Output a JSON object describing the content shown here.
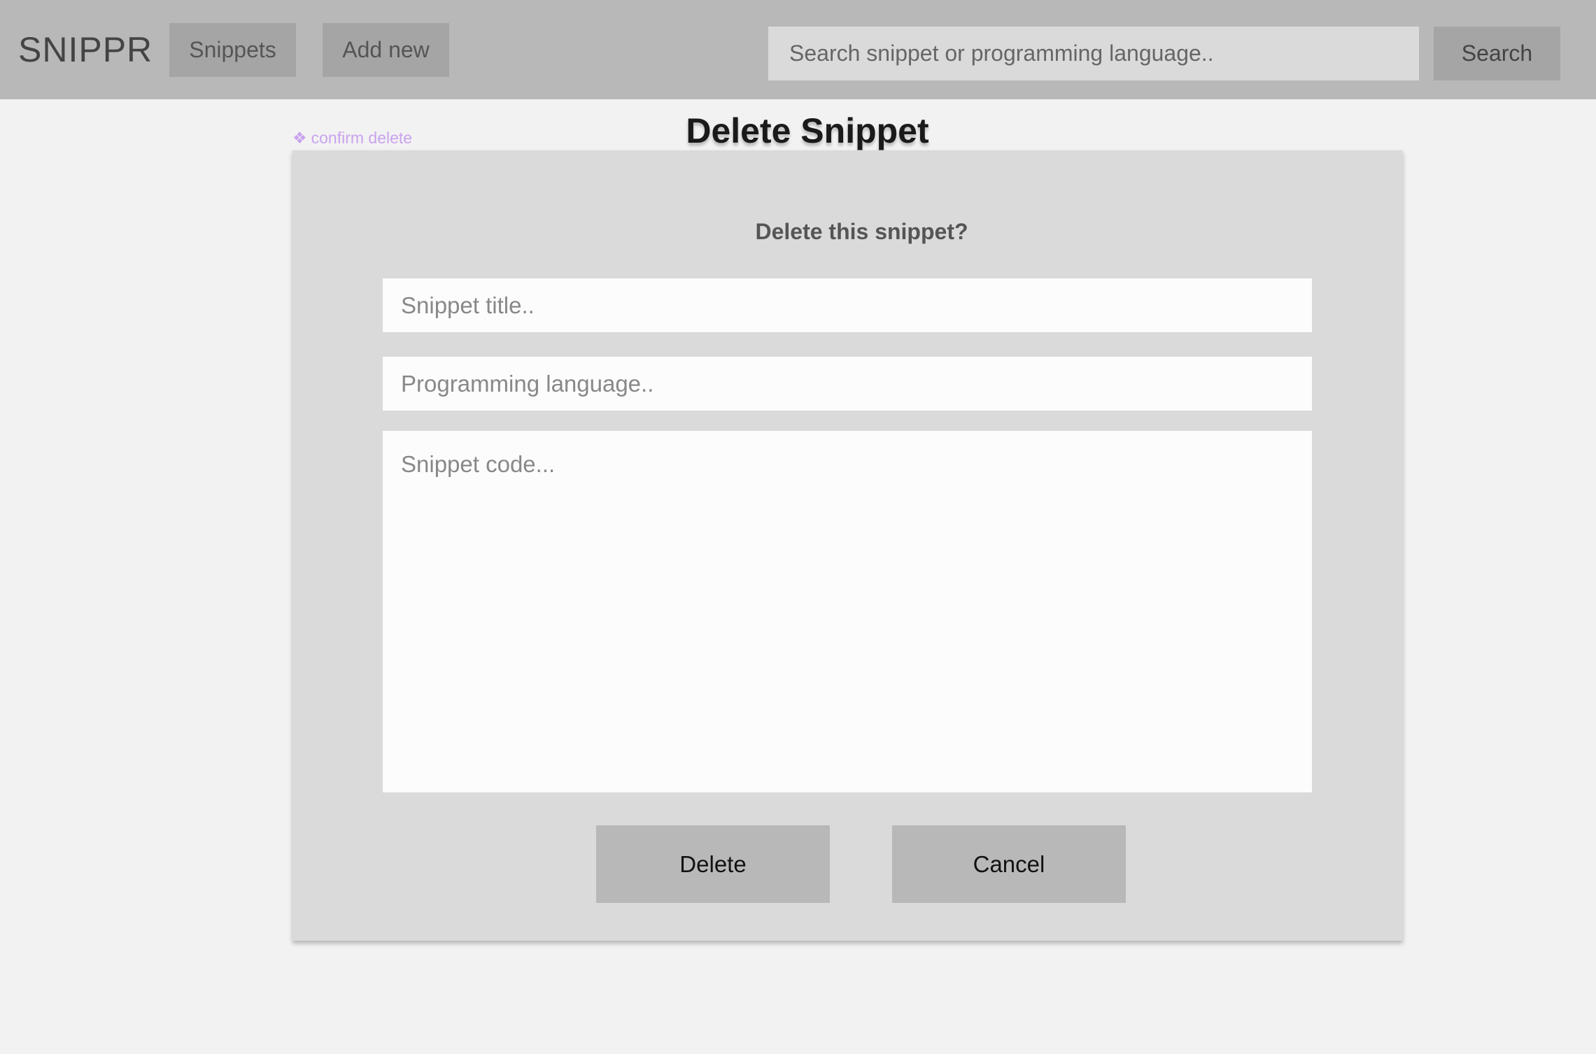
{
  "header": {
    "brand": "SNIPPR",
    "nav": {
      "snippets_label": "Snippets",
      "add_new_label": "Add new"
    },
    "search": {
      "placeholder": "Search snippet or programming language..",
      "value": "",
      "button_label": "Search"
    }
  },
  "annotation": {
    "icon": "❖",
    "label": "confirm delete",
    "color": "#c9a3ef"
  },
  "page": {
    "title": "Delete Snippet"
  },
  "dialog": {
    "question": "Delete this snippet?",
    "title_field": {
      "placeholder": "Snippet title..",
      "value": ""
    },
    "language_field": {
      "placeholder": "Programming language..",
      "value": ""
    },
    "code_field": {
      "placeholder": "Snippet code...",
      "value": ""
    },
    "delete_label": "Delete",
    "cancel_label": "Cancel"
  },
  "colors": {
    "topbar": "#b8b8b8",
    "background": "#f2f2f2",
    "card": "#dadada",
    "button": "#b8b8b8"
  }
}
